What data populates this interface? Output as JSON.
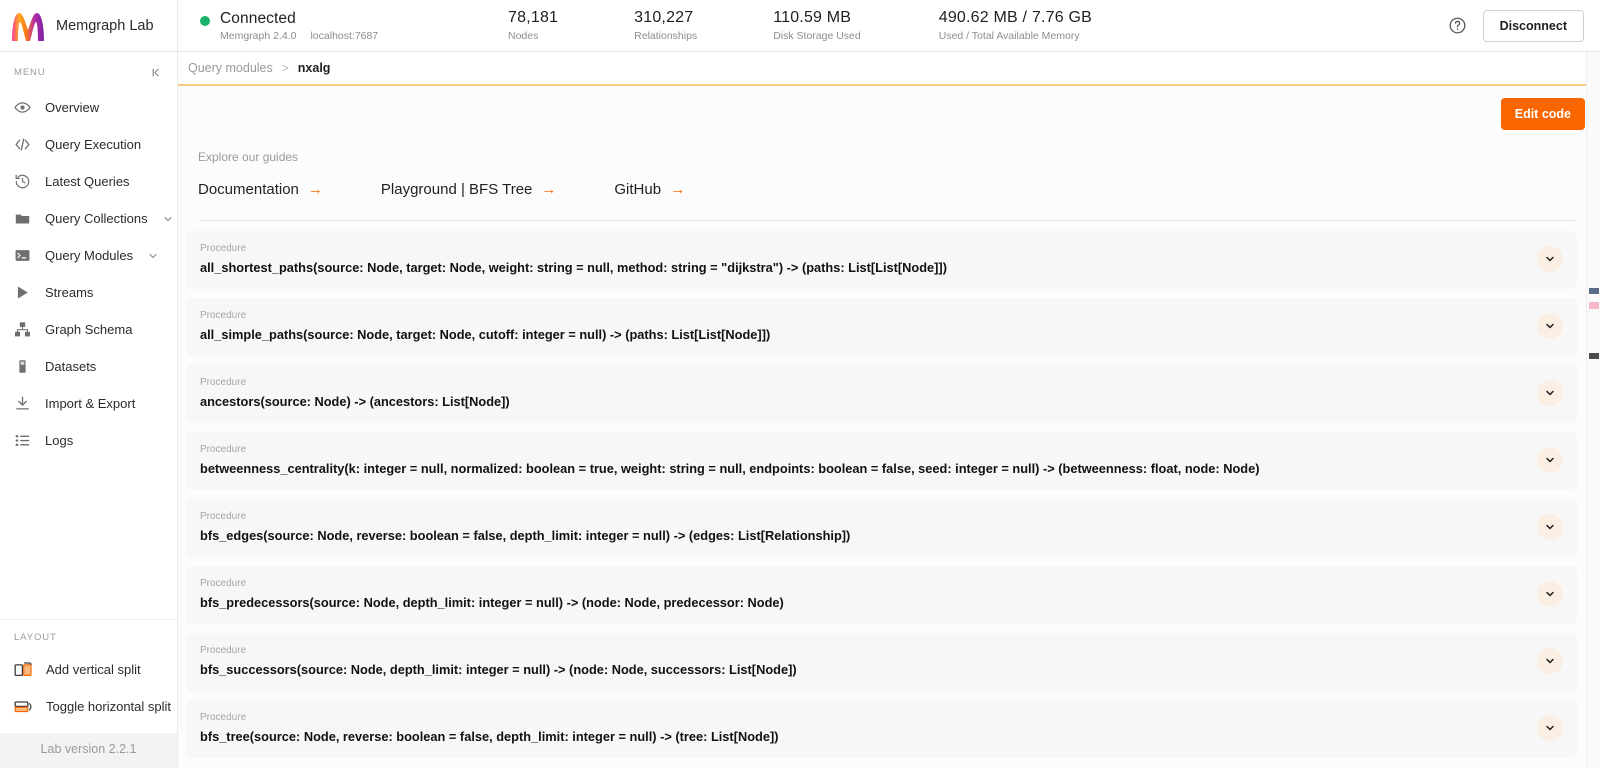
{
  "brand": {
    "name": "Memgraph Lab",
    "logo_icon": "memgraph-logo-icon"
  },
  "connection": {
    "status": "Connected",
    "version": "Memgraph 2.4.0",
    "host": "localhost:7687",
    "status_color": "#19b268"
  },
  "stats": [
    {
      "value": "78,181",
      "label": "Nodes"
    },
    {
      "value": "310,227",
      "label": "Relationships"
    },
    {
      "value": "110.59 MB",
      "label": "Disk Storage Used"
    },
    {
      "value": "490.62 MB / 7.76 GB",
      "label": "Used / Total Available Memory"
    }
  ],
  "top_actions": {
    "help_icon": "help-circle-icon",
    "disconnect_label": "Disconnect"
  },
  "sidebar": {
    "menu_label": "MENU",
    "collapse_icon": "chevron-collapse-icon",
    "items": [
      {
        "label": "Overview",
        "icon": "eye-icon",
        "expandable": false
      },
      {
        "label": "Query Execution",
        "icon": "code-icon",
        "expandable": false
      },
      {
        "label": "Latest Queries",
        "icon": "history-icon",
        "expandable": false
      },
      {
        "label": "Query Collections",
        "icon": "folder-icon",
        "expandable": true
      },
      {
        "label": "Query Modules",
        "icon": "terminal-icon",
        "expandable": true
      },
      {
        "label": "Streams",
        "icon": "play-icon",
        "expandable": false
      },
      {
        "label": "Graph Schema",
        "icon": "schema-icon",
        "expandable": false
      },
      {
        "label": "Datasets",
        "icon": "database-icon",
        "expandable": false
      },
      {
        "label": "Import & Export",
        "icon": "download-icon",
        "expandable": false
      },
      {
        "label": "Logs",
        "icon": "list-icon",
        "expandable": false
      }
    ],
    "layout_label": "LAYOUT",
    "layout_items": [
      {
        "label": "Add vertical split",
        "icon": "add-vertical-split-icon"
      },
      {
        "label": "Toggle horizontal split",
        "icon": "toggle-horizontal-split-icon"
      }
    ],
    "version_label": "Lab version 2.2.1"
  },
  "breadcrumb": {
    "root": "Query modules",
    "separator": ">",
    "current": "nxalg"
  },
  "main": {
    "edit_code_label": "Edit code",
    "guides_label": "Explore our guides",
    "guide_links": [
      {
        "label": "Documentation",
        "arrow": "→"
      },
      {
        "label": "Playground | BFS Tree",
        "arrow": "→"
      },
      {
        "label": "GitHub",
        "arrow": "→"
      }
    ],
    "kind_label": "Procedure",
    "expand_icon": "chevron-down-icon",
    "procedures": [
      {
        "kind": "Procedure",
        "signature": "all_shortest_paths(source: Node, target: Node, weight: string = null, method: string = \"dijkstra\") -> (paths: List[List[Node]])"
      },
      {
        "kind": "Procedure",
        "signature": "all_simple_paths(source: Node, target: Node, cutoff: integer = null) -> (paths: List[List[Node]])"
      },
      {
        "kind": "Procedure",
        "signature": "ancestors(source: Node) -> (ancestors: List[Node])"
      },
      {
        "kind": "Procedure",
        "signature": "betweenness_centrality(k: integer = null, normalized: boolean = true, weight: string = null, endpoints: boolean = false, seed: integer = null) -> (betweenness: float, node: Node)"
      },
      {
        "kind": "Procedure",
        "signature": "bfs_edges(source: Node, reverse: boolean = false, depth_limit: integer = null) -> (edges: List[Relationship])"
      },
      {
        "kind": "Procedure",
        "signature": "bfs_predecessors(source: Node, depth_limit: integer = null) -> (node: Node, predecessor: Node)"
      },
      {
        "kind": "Procedure",
        "signature": "bfs_successors(source: Node, depth_limit: integer = null) -> (node: Node, successors: List[Node])"
      },
      {
        "kind": "Procedure",
        "signature": "bfs_tree(source: Node, reverse: boolean = false, depth_limit: integer = null) -> (tree: List[Node])"
      }
    ]
  },
  "colors": {
    "accent_orange": "#f96600",
    "breadcrumb_underline": "#fbc97f",
    "connected_green": "#19b268",
    "card_bg": "#f7f7f7",
    "chevron_bg": "#fbeee3"
  }
}
